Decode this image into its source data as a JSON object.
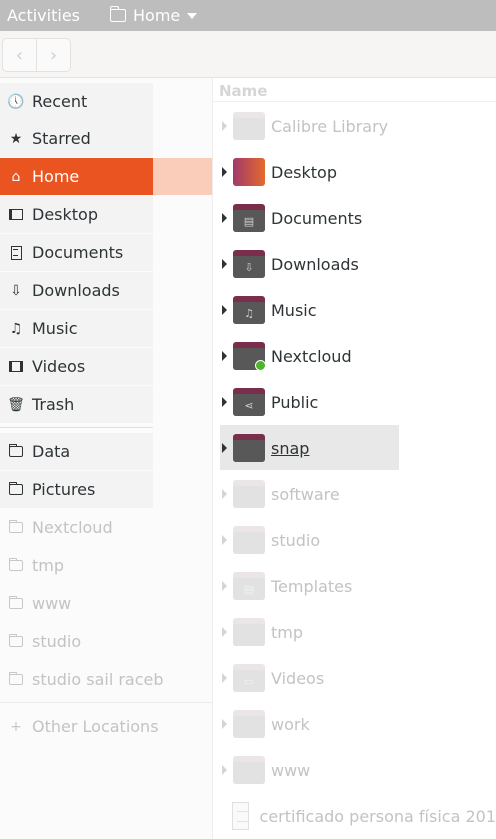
{
  "topbar": {
    "activities": "Activities",
    "app_menu": "Home"
  },
  "sidebar": {
    "items": [
      {
        "label": "Recent",
        "icon": "clock-icon"
      },
      {
        "label": "Starred",
        "icon": "star-icon"
      },
      {
        "label": "Home",
        "icon": "home-icon",
        "active": true
      },
      {
        "label": "Desktop",
        "icon": "desktop-icon"
      },
      {
        "label": "Documents",
        "icon": "document-icon"
      },
      {
        "label": "Downloads",
        "icon": "download-icon"
      },
      {
        "label": "Music",
        "icon": "music-icon"
      },
      {
        "label": "Videos",
        "icon": "video-icon"
      },
      {
        "label": "Trash",
        "icon": "trash-icon"
      }
    ],
    "bookmarks": [
      {
        "label": "Data",
        "icon": "folder-icon"
      },
      {
        "label": "Pictures",
        "icon": "folder-icon"
      },
      {
        "label": "Nextcloud",
        "icon": "folder-icon"
      },
      {
        "label": "tmp",
        "icon": "folder-icon"
      },
      {
        "label": "www",
        "icon": "folder-icon"
      },
      {
        "label": "studio",
        "icon": "folder-icon"
      },
      {
        "label": "studio sail raceb",
        "icon": "folder-icon"
      }
    ],
    "other_locations": "Other Locations"
  },
  "list": {
    "column_name": "Name",
    "rows": [
      {
        "name": "Calibre Library"
      },
      {
        "name": "Desktop"
      },
      {
        "name": "Documents"
      },
      {
        "name": "Downloads"
      },
      {
        "name": "Music"
      },
      {
        "name": "Nextcloud"
      },
      {
        "name": "Public"
      },
      {
        "name": "snap"
      },
      {
        "name": "software"
      },
      {
        "name": "studio"
      },
      {
        "name": "Templates"
      },
      {
        "name": "tmp"
      },
      {
        "name": "Videos"
      },
      {
        "name": "work"
      },
      {
        "name": "www"
      },
      {
        "name": "certificado persona física 201"
      }
    ]
  },
  "colors": {
    "accent": "#e95420",
    "accent_tail": "#f9cdb9",
    "folder_back": "#7b2d4c",
    "folder_front": "#585858"
  }
}
